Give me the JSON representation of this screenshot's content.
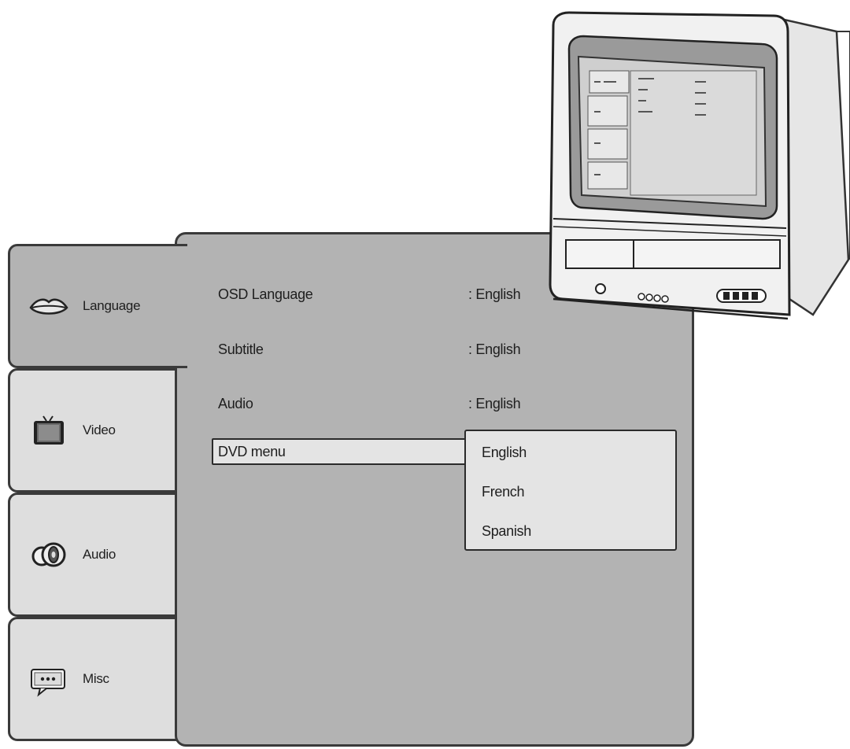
{
  "sidebar": {
    "tabs": [
      {
        "label": "Language",
        "icon": "lips-icon",
        "active": true
      },
      {
        "label": "Video",
        "icon": "tv-icon",
        "active": false
      },
      {
        "label": "Audio",
        "icon": "speaker-icon",
        "active": false
      },
      {
        "label": "Misc",
        "icon": "speech-bubble-icon",
        "active": false
      }
    ]
  },
  "settings": {
    "rows": [
      {
        "label": "OSD Language",
        "value": ": English"
      },
      {
        "label": "Subtitle",
        "value": ": English"
      },
      {
        "label": "Audio",
        "value": ": English"
      },
      {
        "label": "DVD menu",
        "value": ""
      }
    ]
  },
  "dropdown": {
    "options": [
      "English",
      "French",
      "Spanish"
    ]
  },
  "colors": {
    "panel": "#b3b3b3",
    "tab": "#dedede",
    "highlight": "#e4e4e4",
    "border": "#3a3a3a"
  }
}
